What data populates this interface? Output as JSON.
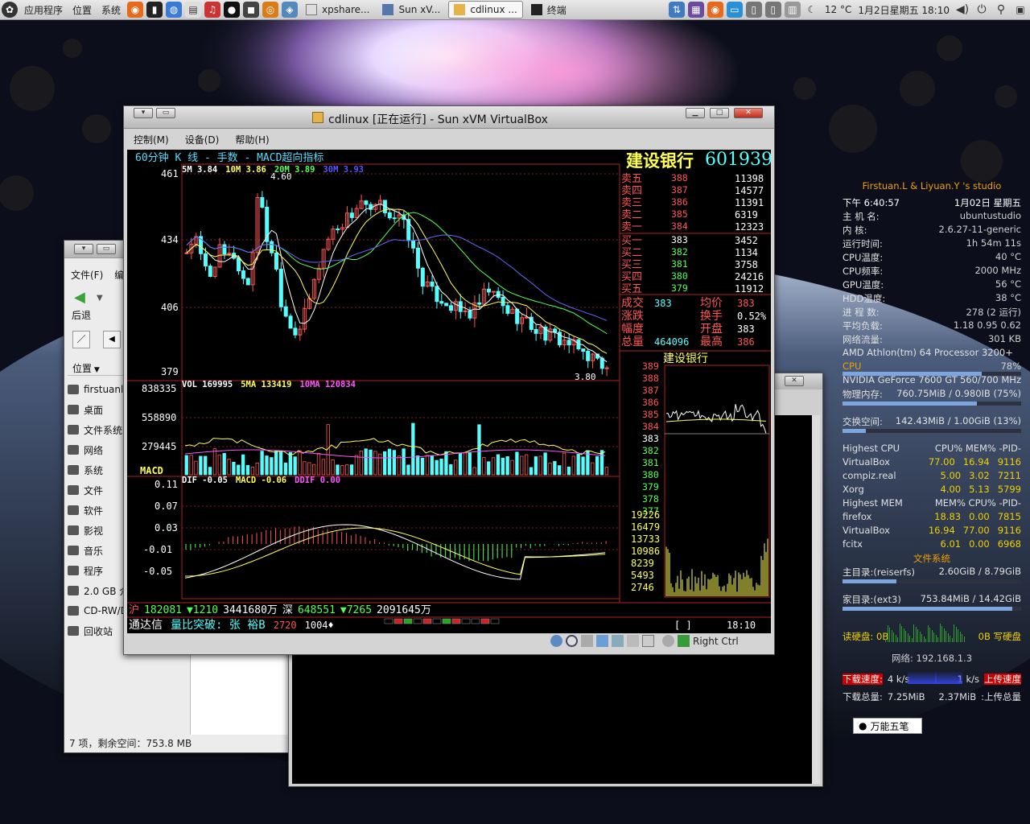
{
  "panel": {
    "menus": [
      "应用程序",
      "位置",
      "系统"
    ],
    "tasks": [
      {
        "label": "xpshare...",
        "icon": "file-icon"
      },
      {
        "label": "Sun xV...",
        "icon": "virtualbox-icon"
      },
      {
        "label": "cdlinux ...",
        "icon": "virtualbox-icon",
        "active": true
      },
      {
        "label": "终端",
        "icon": "terminal-icon"
      }
    ],
    "temperature": "12 °C",
    "datetime": "1月2日星期五 18:10"
  },
  "vbox": {
    "title": "cdlinux [正在运行] - Sun xVM VirtualBox",
    "menu": [
      "控制(M)",
      "设备(D)",
      "帮助(H)"
    ],
    "status_right": "Right Ctrl"
  },
  "stock": {
    "header": "60分钟  K  线 - 手数 - MACD超向指标",
    "name": "建设银行",
    "code": "601939",
    "ma_labels": [
      {
        "text": "5M 3.84",
        "color": "#ffffff"
      },
      {
        "text": "10M 3.86",
        "color": "#ffff55"
      },
      {
        "text": "20M 3.89",
        "color": "#55ff55"
      },
      {
        "text": "30M 3.93",
        "color": "#5555ff"
      }
    ],
    "price_axis": [
      "461",
      "434",
      "406",
      "379"
    ],
    "high_mark": "4.60",
    "low_mark": "3.80",
    "vol_labels": [
      {
        "text": "VOL 169995",
        "color": "#ffffff"
      },
      {
        "text": "5MA 133419",
        "color": "#ffff55"
      },
      {
        "text": "10MA 120834",
        "color": "#ff55ff"
      }
    ],
    "vol_axis": [
      "838335",
      "558890",
      "279445"
    ],
    "macd_title": "MACD",
    "macd_labels": [
      {
        "text": "DIF -0.05",
        "color": "#ffffff"
      },
      {
        "text": "MACD -0.06",
        "color": "#ffff55"
      },
      {
        "text": "DDIF 0.00",
        "color": "#ff55ff"
      }
    ],
    "macd_axis": [
      "0.11",
      "0.07",
      "0.03",
      "-0.01",
      "-0.05"
    ],
    "sell": [
      {
        "label": "卖五",
        "price": "388",
        "vol": "11398"
      },
      {
        "label": "卖四",
        "price": "387",
        "vol": "14577"
      },
      {
        "label": "卖三",
        "price": "386",
        "vol": "11391"
      },
      {
        "label": "卖二",
        "price": "385",
        "vol": "6319"
      },
      {
        "label": "卖一",
        "price": "384",
        "vol": "12323"
      }
    ],
    "buy": [
      {
        "label": "买一",
        "price": "383",
        "vol": "3452"
      },
      {
        "label": "买二",
        "price": "382",
        "vol": "1134"
      },
      {
        "label": "买三",
        "price": "381",
        "vol": "3758"
      },
      {
        "label": "买四",
        "price": "380",
        "vol": "24216"
      },
      {
        "label": "买五",
        "price": "379",
        "vol": "11912"
      }
    ],
    "stats": [
      {
        "l1": "成交",
        "v1": "383",
        "l2": "均价",
        "v2": "383"
      },
      {
        "l1": "涨跌",
        "v1": "",
        "l2": "换手",
        "v2": "0.52%"
      },
      {
        "l1": "幅度",
        "v1": "",
        "l2": "开盘",
        "v2": "383"
      },
      {
        "l1": "总量",
        "v1": "464096",
        "l2": "最高",
        "v2": "386"
      }
    ],
    "mini_title": "建设银行",
    "mini_price_axis": [
      "389",
      "388",
      "387",
      "386",
      "385",
      "384",
      "383",
      "382",
      "381",
      "380",
      "379",
      "378",
      "377"
    ],
    "mini_vol_axis": [
      "19226",
      "16479",
      "13733",
      "10986",
      "8239",
      "5493",
      "2746"
    ],
    "ticker": {
      "sh_label": "沪",
      "sh_index": "182081",
      "sh_change": "▼1210",
      "sh_amount": "3441680万",
      "sz_label": "深",
      "sz_index": "648551",
      "sz_change": "▼7265",
      "sz_amount": "2091645万"
    },
    "status": {
      "app": "通达信",
      "scroll": "量比突破: 张  裕B",
      "v1": "2720",
      "v2": "1004♦",
      "bracket": "[        ]",
      "time": "18:10"
    }
  },
  "filemanager": {
    "menu": [
      "文件(F)",
      "编"
    ],
    "back_label": "后退",
    "places_label": "位置",
    "items": [
      "firstuanl",
      "桌面",
      "文件系统",
      "网络",
      "系统",
      "文件",
      "软件",
      "影视",
      "音乐",
      "程序",
      "2.0 GB 介",
      "CD-RW/D",
      "回收站"
    ],
    "status": "7 项，剩余空间：753.8 MB"
  },
  "conky": {
    "studio": "Firstuan.L & Liyuan.Y 's studio",
    "rows1": [
      [
        "下午 6:40:57",
        "1月02日 星期五"
      ],
      [
        "主 机 名:",
        "ubuntustudio"
      ],
      [
        "内 核:",
        "2.6.27-11-generic"
      ],
      [
        "运行时间:",
        "1h 54m 11s"
      ],
      [
        "CPU温度:",
        "40 °C"
      ],
      [
        "CPU频率:",
        "2000 MHz"
      ],
      [
        "GPU温度:",
        "56 °C"
      ],
      [
        "HDD温度:",
        "38 °C"
      ],
      [
        "进 程 数:",
        "278 (2 运行)"
      ],
      [
        "平均负载:",
        "1.18 0.95 0.62"
      ],
      [
        "网络流量:",
        "301 KB"
      ]
    ],
    "cpu_name": "AMD Athlon(tm) 64 Processor 3200+",
    "cpu_label": "CPU",
    "cpu_percent": "78%",
    "gpu_name": "NVIDIA GeForce 7600 GT",
    "gpu_freq": "560/700 MHz",
    "mem_label": "物理内存:",
    "mem_value": "760.75MiB / 0.980IB (75%)",
    "mem_fill": 0.75,
    "swap_label": "交换空间:",
    "swap_value": "142.43MiB / 1.00GiB (13%)",
    "swap_fill": 0.13,
    "cpu_table_head": [
      "Highest CPU",
      "CPU% MEM% -PID-"
    ],
    "cpu_table": [
      [
        "VirtualBox",
        "77.00",
        "16.94",
        "9116"
      ],
      [
        "compiz.real",
        "5.00",
        "3.02",
        "7211"
      ],
      [
        "Xorg",
        "4.00",
        "5.13",
        "5799"
      ]
    ],
    "mem_table_head": [
      "Highest MEM",
      "MEM% CPU% -PID-"
    ],
    "mem_table": [
      [
        "firefox",
        "18.83",
        "0.00",
        "7815"
      ],
      [
        "VirtualBox",
        "16.94",
        "77.00",
        "9116"
      ],
      [
        "fcitx",
        "6.01",
        "0.00",
        "6968"
      ]
    ],
    "fs_title": "文件系统",
    "fs_root_label": "主目录:(reiserfs)",
    "fs_root_value": "2.60GiB / 8.79GiB",
    "fs_root_fill": 0.3,
    "fs_home_label": "家目录:(ext3)",
    "fs_home_value": "753.84MiB / 14.42GiB",
    "fs_home_fill": 0.95,
    "disk_read_label": "读硬盘: 0B",
    "disk_write_label": "0B 写硬盘",
    "net_label": "网络: 192.168.1.3",
    "down_speed_label": "下载速度:",
    "down_speed": "4 k/s",
    "up_speed": "1 k/s",
    "up_speed_label": "上传速度",
    "down_total_label": "下载总量:",
    "down_total": "7.25MiB",
    "up_total": "2.37MiB",
    "up_total_label": ":上传总量"
  },
  "ime": {
    "label": "万能五笔"
  }
}
